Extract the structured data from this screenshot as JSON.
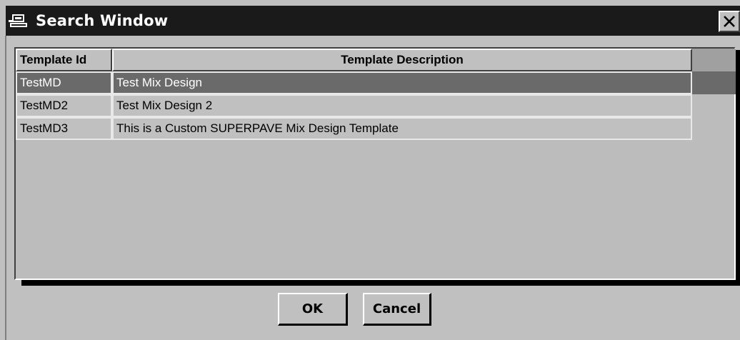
{
  "window": {
    "title": "Search Window",
    "icon": "search-window-app-icon",
    "close_icon": "close-icon"
  },
  "table": {
    "columns": [
      "Template Id",
      "Template Description"
    ],
    "rows": [
      {
        "id": "TestMD",
        "description": "Test Mix Design",
        "selected": true
      },
      {
        "id": "TestMD2",
        "description": "Test Mix Design 2",
        "selected": false
      },
      {
        "id": "TestMD3",
        "description": "This is a Custom SUPERPAVE Mix Design Template",
        "selected": false
      }
    ]
  },
  "buttons": {
    "ok_label": "OK",
    "cancel_label": "Cancel"
  },
  "colors": {
    "titlebar": "#1a1a1a",
    "selected_row": "#6a6a6a",
    "face": "#c0c0c0"
  }
}
